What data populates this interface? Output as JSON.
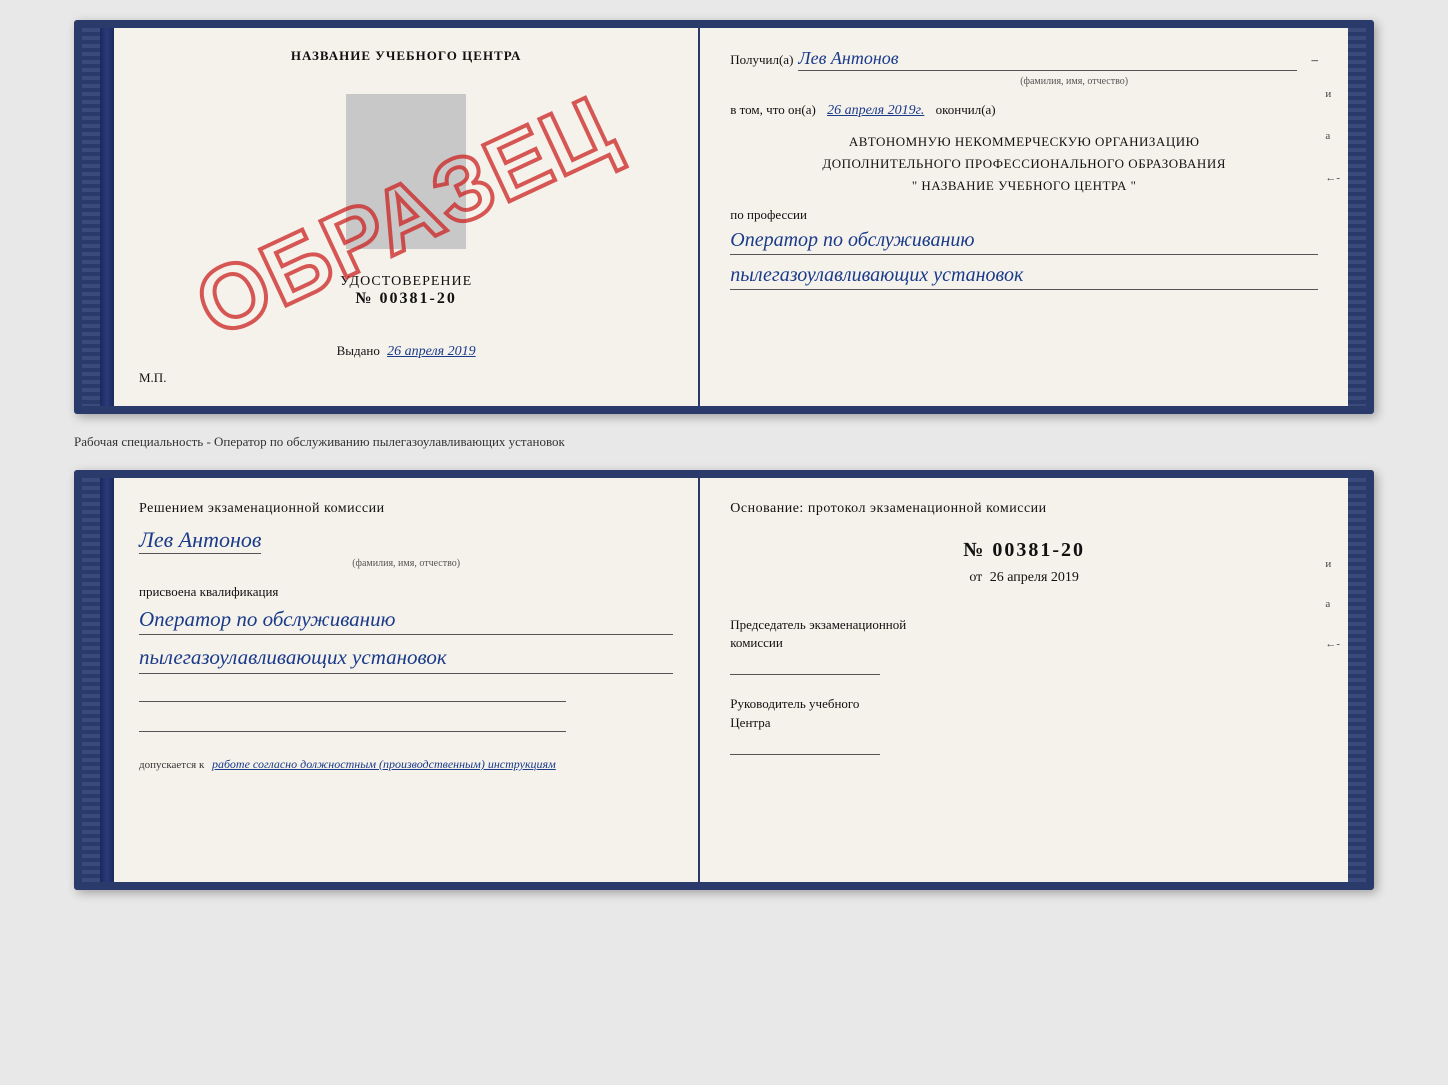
{
  "top_certificate": {
    "left_page": {
      "school_title": "НАЗВАНИЕ УЧЕБНОГО ЦЕНТРА",
      "cert_label": "УДОСТОВЕРЕНИЕ",
      "cert_number": "№ 00381-20",
      "issued_prefix": "Выдано",
      "issued_date": "26 апреля 2019",
      "mp_label": "М.П.",
      "stamp_text": "ОБРАЗЕЦ"
    },
    "right_page": {
      "recipient_prefix": "Получил(а)",
      "recipient_name": "Лев Антонов",
      "recipient_hint": "(фамилия, имя, отчество)",
      "confirm_prefix": "в том, что он(а)",
      "confirm_date": "26 апреля 2019г.",
      "confirm_suffix": "окончил(а)",
      "org_line1": "АВТОНОМНУЮ НЕКОММЕРЧЕСКУЮ ОРГАНИЗАЦИЮ",
      "org_line2": "ДОПОЛНИТЕЛЬНОГО ПРОФЕССИОНАЛЬНОГО ОБРАЗОВАНИЯ",
      "org_line3": "\"   НАЗВАНИЕ УЧЕБНОГО ЦЕНТРА   \"",
      "profession_prefix": "по профессии",
      "profession_line1": "Оператор по обслуживанию",
      "profession_line2": "пылегазоулавливающих установок"
    }
  },
  "separator": {
    "text": "Рабочая специальность - Оператор по обслуживанию пылегазоулавливающих установок"
  },
  "bottom_certificate": {
    "left_page": {
      "commission_text": "Решением экзаменационной комиссии",
      "person_name": "Лев Антонов",
      "fio_hint": "(фамилия, имя, отчество)",
      "assigned_label": "присвоена квалификация",
      "qualification_line1": "Оператор по обслуживанию",
      "qualification_line2": "пылегазоулавливающих установок",
      "allowed_prefix": "допускается к",
      "allowed_text": "работе согласно должностным (производственным) инструкциям"
    },
    "right_page": {
      "basis_text": "Основание: протокол экзаменационной комиссии",
      "protocol_number": "№ 00381-20",
      "date_prefix": "от",
      "date_value": "26 апреля 2019",
      "chairman_label_line1": "Председатель экзаменационной",
      "chairman_label_line2": "комиссии",
      "director_label_line1": "Руководитель учебного",
      "director_label_line2": "Центра"
    }
  },
  "side_marks": {
    "mark_and": "и",
    "mark_a": "а",
    "mark_arrow": "←-"
  }
}
